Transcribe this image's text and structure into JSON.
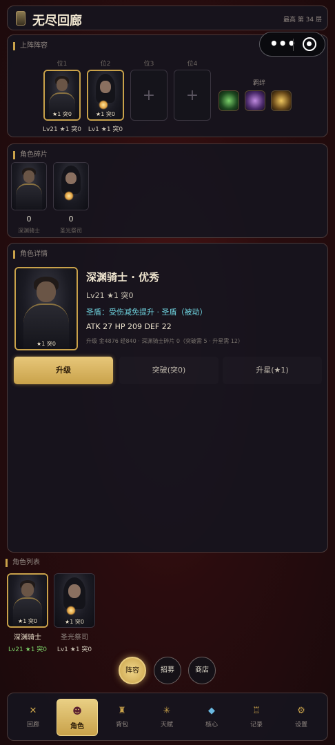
{
  "header": {
    "title": "无尽回廊",
    "floor": "最高 第 34 层"
  },
  "lineup": {
    "section_title": "上阵阵容",
    "slots": [
      {
        "label": "位1",
        "info": "Lv21 ★1 突0",
        "badge": "★1 突0"
      },
      {
        "label": "位2",
        "info": "Lv1 ★1 突0",
        "badge": "★1 突0"
      },
      {
        "label": "位3"
      },
      {
        "label": "位4"
      }
    ],
    "bond_title": "羁绊",
    "bond_icons": [
      "green-swirl-icon",
      "purple-orb-icon",
      "golden-mask-icon"
    ]
  },
  "fragments": {
    "section_title": "角色碎片",
    "items": [
      {
        "count": "0",
        "name": "深渊骑士"
      },
      {
        "count": "0",
        "name": "圣光祭司"
      }
    ]
  },
  "detail": {
    "section_title": "角色详情",
    "name": "深渊骑士 · 优秀",
    "level": "Lv21 ★1 突0",
    "skill": "圣盾：受伤减免提升 · 圣盾（被动）",
    "stats": "ATK 27   HP 209   DEF 22",
    "cost": "升级 金4876 经840  ·  深渊骑士碎片 0（突破需 5 · 升星需 12）",
    "badge": "★1 突0",
    "actions": {
      "upgrade": "升级",
      "breakthrough": "突破(突0)",
      "star": "升星(★1)"
    }
  },
  "roster": {
    "section_title": "角色列表",
    "items": [
      {
        "name": "深渊骑士",
        "level": "Lv21 ★1 突0",
        "badge": "★1 突0"
      },
      {
        "name": "圣光祭司",
        "level": "Lv1 ★1 突0",
        "badge": "★1 突0"
      }
    ]
  },
  "subnav": {
    "lineup": "阵容",
    "recruit": "招募",
    "shop": "商店"
  },
  "tabs": [
    {
      "label": "回廊",
      "icon": "crossed-swords-icon"
    },
    {
      "label": "角色",
      "icon": "character-icon"
    },
    {
      "label": "背包",
      "icon": "bag-icon"
    },
    {
      "label": "天赋",
      "icon": "talent-icon"
    },
    {
      "label": "核心",
      "icon": "core-gem-icon"
    },
    {
      "label": "记录",
      "icon": "record-icon"
    },
    {
      "label": "设置",
      "icon": "gear-icon"
    }
  ],
  "colors": {
    "accent": "#c9a24a",
    "skill_text": "#6fd4e0",
    "level_green": "#7ed46a",
    "background": "#2a0c0e"
  }
}
